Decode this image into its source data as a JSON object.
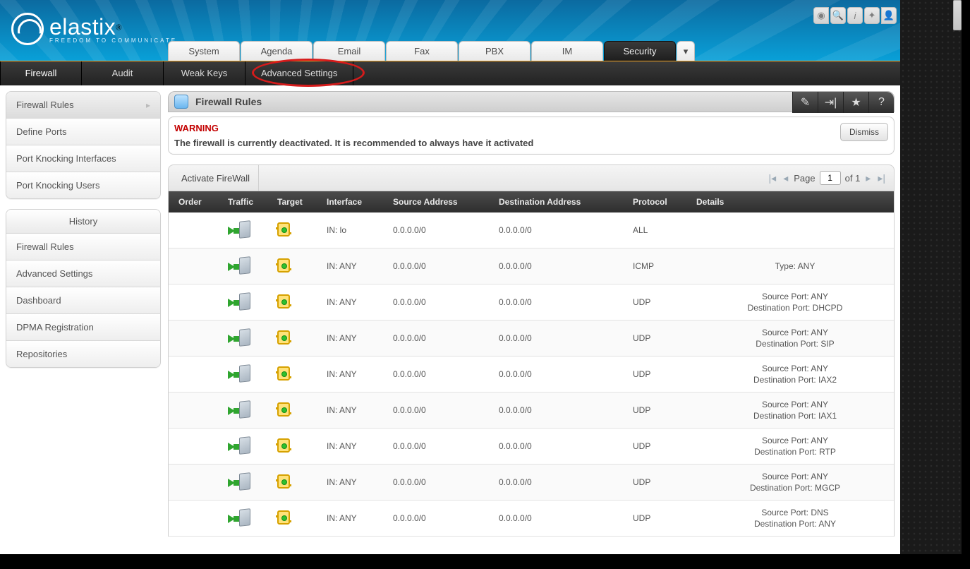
{
  "brand": {
    "name": "elastix",
    "reg": "®",
    "tagline": "FREEDOM TO COMMUNICATE"
  },
  "quick_icons": [
    "droplet",
    "search",
    "info",
    "puzzle",
    "user"
  ],
  "main_tabs": {
    "items": [
      "System",
      "Agenda",
      "Email",
      "Fax",
      "PBX",
      "IM",
      "Security"
    ],
    "active": "Security",
    "caret": "▾"
  },
  "subnav": {
    "items": [
      "Firewall",
      "Audit",
      "Weak Keys",
      "Advanced Settings"
    ],
    "active": "Firewall",
    "ring_on": "Advanced Settings"
  },
  "sidebar": {
    "primary": [
      {
        "label": "Firewall Rules",
        "active": true,
        "arrow": "▸"
      },
      {
        "label": "Define Ports"
      },
      {
        "label": "Port Knocking Interfaces"
      },
      {
        "label": "Port Knocking Users"
      }
    ],
    "history_header": "History",
    "history": [
      {
        "label": "Firewall Rules"
      },
      {
        "label": "Advanced Settings"
      },
      {
        "label": "Dashboard"
      },
      {
        "label": "DPMA Registration"
      },
      {
        "label": "Repositories"
      }
    ]
  },
  "page": {
    "title": "Firewall Rules",
    "toolbar_icons": [
      "edit",
      "columns",
      "star",
      "help"
    ]
  },
  "warning": {
    "title": "WARNING",
    "text": "The firewall is currently deactivated. It is recommended to always have it activated",
    "dismiss": "Dismiss"
  },
  "toolbar": {
    "activate": "Activate FireWall",
    "page_label": "Page",
    "page_value": "1",
    "of_label": "of 1"
  },
  "table": {
    "headers": [
      "Order",
      "Traffic",
      "Target",
      "Interface",
      "Source Address",
      "Destination Address",
      "Protocol",
      "Details"
    ],
    "rows": [
      {
        "interface": "IN: lo",
        "src": "0.0.0.0/0",
        "dst": "0.0.0.0/0",
        "proto": "ALL",
        "details": ""
      },
      {
        "interface": "IN: ANY",
        "src": "0.0.0.0/0",
        "dst": "0.0.0.0/0",
        "proto": "ICMP",
        "details": "Type: ANY"
      },
      {
        "interface": "IN: ANY",
        "src": "0.0.0.0/0",
        "dst": "0.0.0.0/0",
        "proto": "UDP",
        "details": "Source Port: ANY\nDestination Port: DHCPD"
      },
      {
        "interface": "IN: ANY",
        "src": "0.0.0.0/0",
        "dst": "0.0.0.0/0",
        "proto": "UDP",
        "details": "Source Port: ANY\nDestination Port: SIP"
      },
      {
        "interface": "IN: ANY",
        "src": "0.0.0.0/0",
        "dst": "0.0.0.0/0",
        "proto": "UDP",
        "details": "Source Port: ANY\nDestination Port: IAX2"
      },
      {
        "interface": "IN: ANY",
        "src": "0.0.0.0/0",
        "dst": "0.0.0.0/0",
        "proto": "UDP",
        "details": "Source Port: ANY\nDestination Port: IAX1"
      },
      {
        "interface": "IN: ANY",
        "src": "0.0.0.0/0",
        "dst": "0.0.0.0/0",
        "proto": "UDP",
        "details": "Source Port: ANY\nDestination Port: RTP"
      },
      {
        "interface": "IN: ANY",
        "src": "0.0.0.0/0",
        "dst": "0.0.0.0/0",
        "proto": "UDP",
        "details": "Source Port: ANY\nDestination Port: MGCP"
      },
      {
        "interface": "IN: ANY",
        "src": "0.0.0.0/0",
        "dst": "0.0.0.0/0",
        "proto": "UDP",
        "details": "Source Port: DNS\nDestination Port: ANY"
      }
    ]
  }
}
